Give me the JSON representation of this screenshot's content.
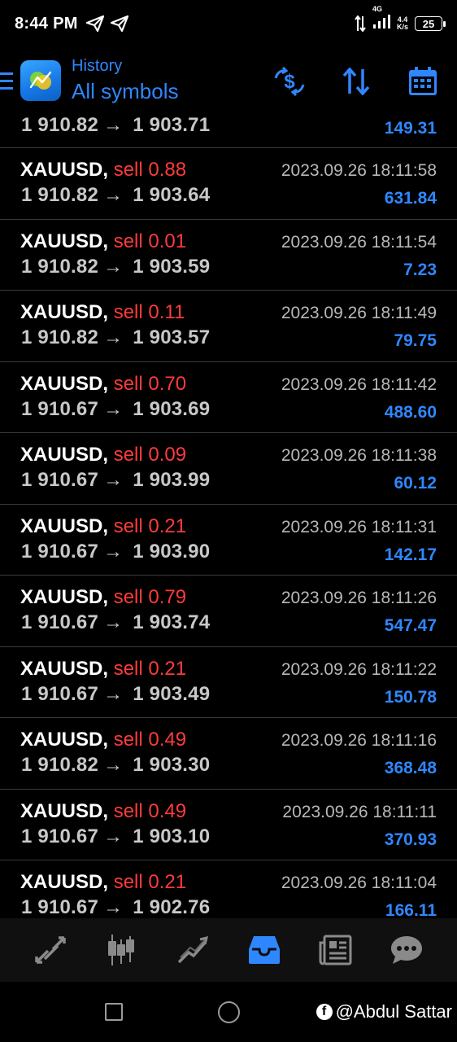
{
  "status_bar": {
    "time": "8:44 PM",
    "network": "4G",
    "speed_value": "4.4",
    "speed_unit": "K/s",
    "battery": "25"
  },
  "header": {
    "subtitle": "History",
    "title": "All symbols",
    "accent_color": "#2f87ff"
  },
  "partial_row": {
    "price_open": "1 910.82",
    "price_close": "1 903.71",
    "profit": "149.31"
  },
  "trades": [
    {
      "symbol": "XAUUSD,",
      "side": "sell 0.88",
      "time": "2023.09.26 18:11:58",
      "price_open": "1 910.82",
      "price_close": "1 903.64",
      "profit": "631.84"
    },
    {
      "symbol": "XAUUSD,",
      "side": "sell 0.01",
      "time": "2023.09.26 18:11:54",
      "price_open": "1 910.82",
      "price_close": "1 903.59",
      "profit": "7.23"
    },
    {
      "symbol": "XAUUSD,",
      "side": "sell 0.11",
      "time": "2023.09.26 18:11:49",
      "price_open": "1 910.82",
      "price_close": "1 903.57",
      "profit": "79.75"
    },
    {
      "symbol": "XAUUSD,",
      "side": "sell 0.70",
      "time": "2023.09.26 18:11:42",
      "price_open": "1 910.67",
      "price_close": "1 903.69",
      "profit": "488.60"
    },
    {
      "symbol": "XAUUSD,",
      "side": "sell 0.09",
      "time": "2023.09.26 18:11:38",
      "price_open": "1 910.67",
      "price_close": "1 903.99",
      "profit": "60.12"
    },
    {
      "symbol": "XAUUSD,",
      "side": "sell 0.21",
      "time": "2023.09.26 18:11:31",
      "price_open": "1 910.67",
      "price_close": "1 903.90",
      "profit": "142.17"
    },
    {
      "symbol": "XAUUSD,",
      "side": "sell 0.79",
      "time": "2023.09.26 18:11:26",
      "price_open": "1 910.67",
      "price_close": "1 903.74",
      "profit": "547.47"
    },
    {
      "symbol": "XAUUSD,",
      "side": "sell 0.21",
      "time": "2023.09.26 18:11:22",
      "price_open": "1 910.67",
      "price_close": "1 903.49",
      "profit": "150.78"
    },
    {
      "symbol": "XAUUSD,",
      "side": "sell 0.49",
      "time": "2023.09.26 18:11:16",
      "price_open": "1 910.82",
      "price_close": "1 903.30",
      "profit": "368.48"
    },
    {
      "symbol": "XAUUSD,",
      "side": "sell 0.49",
      "time": "2023.09.26 18:11:11",
      "price_open": "1 910.67",
      "price_close": "1 903.10",
      "profit": "370.93"
    },
    {
      "symbol": "XAUUSD,",
      "side": "sell 0.21",
      "time": "2023.09.26 18:11:04",
      "price_open": "1 910.67",
      "price_close": "1 902.76",
      "profit": "166.11"
    }
  ],
  "arrow_glyph": "→",
  "colors": {
    "sell": "#ff3b3b",
    "profit": "#2f87ff",
    "active_nav": "#2f87ff",
    "inactive_nav": "#8a8a8a"
  },
  "bottom_nav": [
    "quotes-icon",
    "chart-icon",
    "trade-icon",
    "history-icon",
    "news-icon",
    "messages-icon"
  ],
  "watermark": "@Abdul Sattar"
}
